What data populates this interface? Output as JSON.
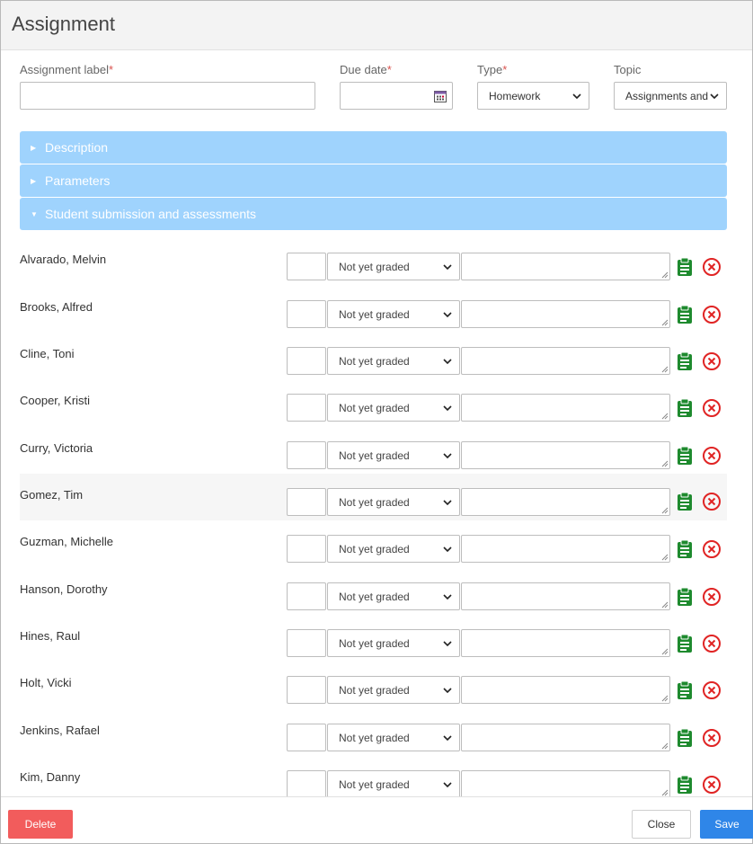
{
  "dialog": {
    "title": "Assignment"
  },
  "form": {
    "assignment_label": {
      "label": "Assignment label",
      "required_mark": "*",
      "value": ""
    },
    "due_date": {
      "label": "Due date",
      "required_mark": "*",
      "value": ""
    },
    "type": {
      "label": "Type",
      "required_mark": "*",
      "selected": "Homework"
    },
    "topic": {
      "label": "Topic",
      "selected": "Assignments and"
    }
  },
  "accordion": [
    {
      "label": "Description",
      "expanded": false
    },
    {
      "label": "Parameters",
      "expanded": false
    },
    {
      "label": "Student submission and assessments",
      "expanded": true
    }
  ],
  "students": [
    {
      "name": "Alvarado, Melvin",
      "grade": "",
      "status": "Not yet graded",
      "comment": ""
    },
    {
      "name": "Brooks, Alfred",
      "grade": "",
      "status": "Not yet graded",
      "comment": ""
    },
    {
      "name": "Cline, Toni",
      "grade": "",
      "status": "Not yet graded",
      "comment": ""
    },
    {
      "name": "Cooper, Kristi",
      "grade": "",
      "status": "Not yet graded",
      "comment": ""
    },
    {
      "name": "Curry, Victoria",
      "grade": "",
      "status": "Not yet graded",
      "comment": ""
    },
    {
      "name": "Gomez, Tim",
      "grade": "",
      "status": "Not yet graded",
      "comment": ""
    },
    {
      "name": "Guzman, Michelle",
      "grade": "",
      "status": "Not yet graded",
      "comment": ""
    },
    {
      "name": "Hanson, Dorothy",
      "grade": "",
      "status": "Not yet graded",
      "comment": ""
    },
    {
      "name": "Hines, Raul",
      "grade": "",
      "status": "Not yet graded",
      "comment": ""
    },
    {
      "name": "Holt, Vicki",
      "grade": "",
      "status": "Not yet graded",
      "comment": ""
    },
    {
      "name": "Jenkins, Rafael",
      "grade": "",
      "status": "Not yet graded",
      "comment": ""
    },
    {
      "name": "Kim, Danny",
      "grade": "",
      "status": "Not yet graded",
      "comment": ""
    }
  ],
  "icons": {
    "clipboard": "clipboard-icon",
    "remove": "close-circle-icon",
    "calendar": "calendar-icon",
    "dropdown": "chevron-down-icon",
    "expand": "caret-right-icon",
    "collapse": "caret-down-icon"
  },
  "colors": {
    "accordion": "#9fd3fd",
    "clipboard": "#1e8a2e",
    "remove": "#e02424",
    "delete": "#f25c5c",
    "save": "#2f86e8",
    "required": "#d9534f"
  },
  "footer": {
    "delete_label": "Delete",
    "close_label": "Close",
    "save_label": "Save"
  }
}
